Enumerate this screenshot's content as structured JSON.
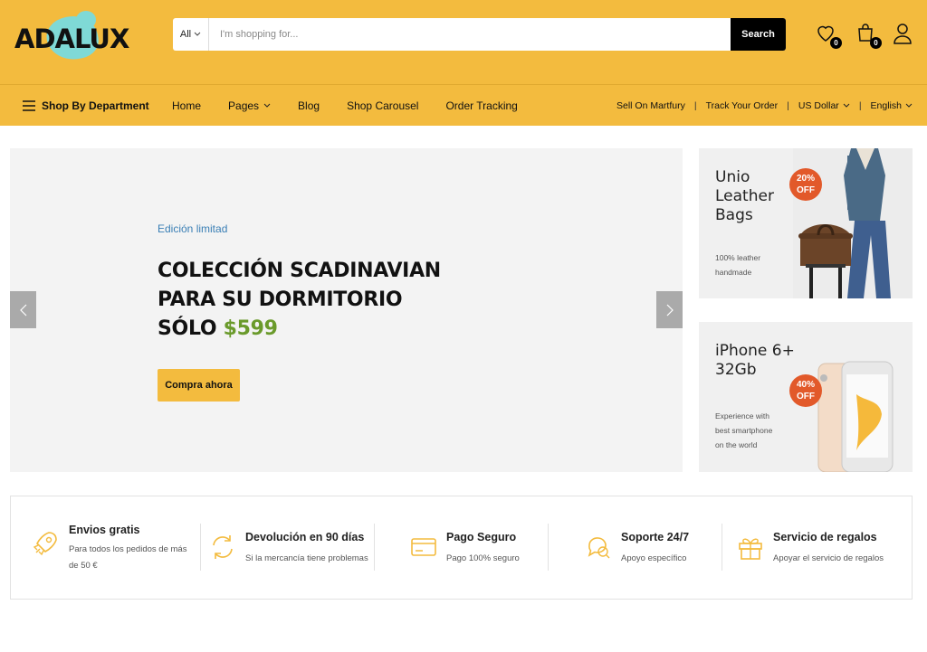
{
  "header": {
    "logo_text": "ADALUX",
    "search": {
      "category": "All",
      "placeholder": "I'm shopping for...",
      "button": "Search"
    },
    "wishlist_count": "0",
    "cart_count": "0"
  },
  "nav": {
    "department": "Shop By Department",
    "menu": [
      "Home",
      "Pages",
      "Blog",
      "Shop Carousel",
      "Order Tracking"
    ],
    "right": {
      "sell": "Sell On Martfury",
      "track": "Track Your Order",
      "currency": "US Dollar",
      "language": "English"
    }
  },
  "hero": {
    "kicker": "Edición limitad",
    "line1": "COLECCIÓN SCADINAVIAN",
    "line2": "PARA SU DORMITORIO",
    "line3_prefix": "SÓLO ",
    "price": "$599",
    "cta": "Compra ahora"
  },
  "promos": [
    {
      "title_lines": [
        "Unio",
        "Leather",
        "Bags"
      ],
      "desc_lines": [
        "100% leather",
        "handmade"
      ],
      "badge_lines": [
        "20%",
        "OFF"
      ]
    },
    {
      "title_lines": [
        "iPhone 6+",
        "32Gb"
      ],
      "desc_lines": [
        "Experience with",
        "best smartphone",
        "on the world"
      ],
      "badge_lines": [
        "40%",
        "OFF"
      ]
    }
  ],
  "features": [
    {
      "icon": "rocket-icon",
      "title": "Envios gratis",
      "sub_lines": [
        "Para todos los pedidos de más",
        "de 50 €"
      ]
    },
    {
      "icon": "refresh-icon",
      "title": "Devolución en 90 días",
      "sub_lines": [
        "Si la mercancía tiene problemas"
      ]
    },
    {
      "icon": "credit-card-icon",
      "title": "Pago Seguro",
      "sub_lines": [
        "Pago 100% seguro"
      ]
    },
    {
      "icon": "chat-support-icon",
      "title": "Soporte 24/7",
      "sub_lines": [
        "Apoyo específico"
      ]
    },
    {
      "icon": "gift-icon",
      "title": "Servicio de regalos",
      "sub_lines": [
        "Apoyar el servicio de regalos"
      ]
    }
  ],
  "colors": {
    "brand_yellow": "#f3bb3e",
    "price_green": "#6a9a2b",
    "kicker_blue": "#3a7fb5",
    "badge_orange": "#e2592a",
    "feature_icon": "#f3bb3e"
  }
}
